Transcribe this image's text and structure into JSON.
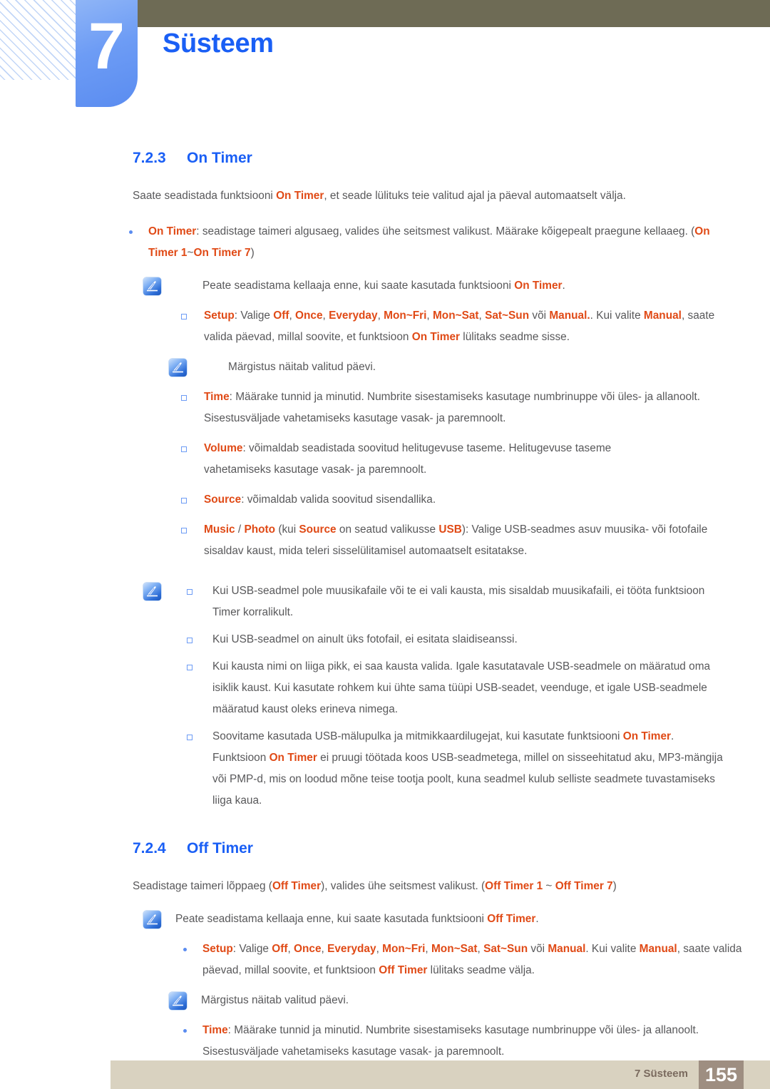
{
  "header": {
    "chapter_number": "7",
    "chapter_title": "Süsteem"
  },
  "footer": {
    "label": "7 Süsteem",
    "page_number": "155"
  },
  "colors": {
    "heading_blue": "#1a5ff5",
    "highlight_orange": "#e04a16",
    "body_gray": "#58585a",
    "olive_bar": "#6e6b55",
    "tab_blue": "#6d9cf5",
    "footer_bar": "#d9d2c0",
    "footer_page_box": "#9e8e81"
  },
  "sections": [
    {
      "id": "on-timer",
      "number": "7.2.3",
      "title": "On Timer",
      "intro": {
        "p1": "Saate seadistada funktsiooni ",
        "hl1": "On Timer",
        "p2": ", et seade lülituks teie valitud ajal ja päeval automaatselt välja."
      },
      "bullet_on_timer": {
        "hl1": "On Timer",
        "t1": ": seadistage taimeri algusaeg, valides ühe seitsmest valikust. Määrake kõigepealt praegune kellaaeg. (",
        "hl2": "On Timer 1",
        "t2": "~",
        "hl3": "On Timer 7",
        "t3": ")"
      },
      "note_clock": {
        "t1": "Peate seadistama kellaaja enne, kui saate kasutada funktsiooni ",
        "hl1": "On Timer",
        "t2": "."
      },
      "bullet_setup": {
        "hl_label": "Setup",
        "t1": ": Valige ",
        "hl_off": "Off",
        "t2": ", ",
        "hl_once": "Once",
        "t3": ", ",
        "hl_everyday": "Everyday",
        "t4": ", ",
        "hl_monfri": "Mon~Fri",
        "t5": ", ",
        "hl_monsat": "Mon~Sat",
        "t6": ", ",
        "hl_satsun": "Sat~Sun",
        "t7": " või ",
        "hl_manual": "Manual.",
        "t8": ". Kui valite ",
        "hl_manual2": "Manual",
        "t9": ", saate valida päevad, millal soovite, et funktsioon ",
        "hl_ontimer": "On Timer",
        "t10": " lülitaks seadme sisse."
      },
      "note_marking": "Märgistus näitab valitud päevi.",
      "bullet_time": {
        "hl_label": "Time",
        "text": ": Määrake tunnid ja minutid. Numbrite sisestamiseks kasutage numbrinuppe või üles- ja allanoolt. Sisestusväljade vahetamiseks kasutage vasak- ja paremnoolt."
      },
      "bullet_volume": {
        "hl_label": "Volume",
        "text": ": võimaldab seadistada soovitud helitugevuse taseme. Helitugevuse taseme vahetamiseks kasutage vasak- ja paremnoolt."
      },
      "bullet_source": {
        "hl_label": "Source",
        "text": ": võimaldab valida soovitud sisendallika."
      },
      "bullet_music_photo": {
        "hl_music": "Music",
        "sep": " / ",
        "hl_photo": "Photo",
        "t1": " (kui ",
        "hl_source": "Source",
        "t2": " on seatud valikusse ",
        "hl_usb": "USB",
        "t3": "): Valige USB-seadmes asuv muusika- või fotofaile sisaldav kaust, mida teleri sisselülitamisel automaatselt esitatakse."
      },
      "notes_usb": [
        {
          "text": "Kui USB-seadmel pole muusikafaile või te ei vali kausta, mis sisaldab muusikafaili, ei tööta funktsioon Timer korralikult."
        },
        {
          "text": "Kui USB-seadmel on ainult üks fotofail, ei esitata slaidiseanssi."
        },
        {
          "text": "Kui kausta nimi on liiga pikk, ei saa kausta valida. Igale kasutatavale USB-seadmele on määratud oma isiklik kaust. Kui kasutate rohkem kui ühte sama tüüpi USB-seadet, veenduge, et igale USB-seadmele määratud kaust oleks erineva nimega."
        },
        {
          "t1": "Soovitame kasutada USB-mälupulka ja mitmikkaardilugejat, kui kasutate funktsiooni ",
          "hl1": "On Timer",
          "t2": ". Funktsioon ",
          "hl2": "On Timer",
          "t3": " ei pruugi töötada koos USB-seadmetega, millel on sisseehitatud aku, MP3-mängija või PMP-d, mis on loodud mõne teise tootja poolt, kuna seadmel kulub selliste seadmete tuvastamiseks liiga kaua."
        }
      ]
    },
    {
      "id": "off-timer",
      "number": "7.2.4",
      "title": "Off Timer",
      "intro": {
        "t1": "Seadistage taimeri lõppaeg (",
        "hl1": "Off Timer",
        "t2": "), valides ühe seitsmest valikust. (",
        "hl2": "Off Timer 1",
        "t3": " ~ ",
        "hl3": "Off Timer 7",
        "t4": ")"
      },
      "note_clock": {
        "t1": "Peate seadistama kellaaja enne, kui saate kasutada funktsiooni ",
        "hl1": "Off Timer",
        "t2": "."
      },
      "bullet_setup": {
        "hl_label": "Setup",
        "t1": ": Valige ",
        "hl_off": "Off",
        "t2": ", ",
        "hl_once": "Once",
        "t3": ", ",
        "hl_everyday": "Everyday",
        "t4": ", ",
        "hl_monfri": "Mon~Fri",
        "t5": ", ",
        "hl_monsat": "Mon~Sat",
        "t6": ", ",
        "hl_satsun": "Sat~Sun",
        "t7": " või ",
        "hl_manual": "Manual",
        "t8": ". Kui valite ",
        "hl_manual2": "Manual",
        "t9": ", saate valida päevad, millal soovite, et funktsioon ",
        "hl_offtimer": "Off Timer",
        "t10": " lülitaks seadme välja."
      },
      "note_marking": "Märgistus näitab valitud päevi.",
      "bullet_time": {
        "hl_label": "Time",
        "text": ": Määrake tunnid ja minutid. Numbrite sisestamiseks kasutage numbrinuppe või üles- ja allanoolt. Sisestusväljade vahetamiseks kasutage vasak- ja paremnoolt."
      }
    }
  ]
}
